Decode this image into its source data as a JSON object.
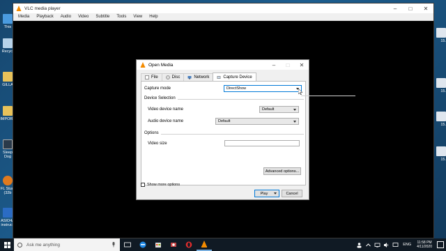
{
  "desktop": {
    "left_icons": [
      {
        "label": "This",
        "icon": "this-pc-icon"
      },
      {
        "label": "Recycl",
        "icon": "recycle-bin-icon"
      },
      {
        "label": "GILLA",
        "icon": "folder-icon"
      },
      {
        "label": "IMPORT",
        "icon": "folder-icon"
      },
      {
        "label": "Sleep Dog",
        "icon": "app-icon"
      },
      {
        "label": "FL Studi (32b",
        "icon": "fl-studio-icon"
      },
      {
        "label": "ASIO4A instructi",
        "icon": "document-icon"
      }
    ],
    "right_icons": [
      {
        "label": "15.",
        "icon": "file-icon"
      },
      {
        "label": "15.",
        "icon": "file-icon"
      },
      {
        "label": "15.",
        "icon": "file-icon"
      },
      {
        "label": "15.",
        "icon": "file-icon"
      }
    ]
  },
  "vlc": {
    "title": "VLC media player",
    "menu": [
      "Media",
      "Playback",
      "Audio",
      "Video",
      "Subtitle",
      "Tools",
      "View",
      "Help"
    ]
  },
  "dialog": {
    "title": "Open Media",
    "tabs": [
      {
        "label": "File",
        "icon": "file-tab-icon"
      },
      {
        "label": "Disc",
        "icon": "disc-tab-icon"
      },
      {
        "label": "Network",
        "icon": "network-tab-icon"
      },
      {
        "label": "Capture Device",
        "icon": "capture-device-tab-icon"
      }
    ],
    "active_tab": "Capture Device",
    "capture_mode_label": "Capture mode",
    "capture_mode_value": "DirectShow",
    "device_selection_label": "Device Selection",
    "video_device_label": "Video device name",
    "video_device_value": "Default",
    "audio_device_label": "Audio device name",
    "audio_device_value": "Default",
    "options_label": "Options",
    "video_size_label": "Video size",
    "video_size_value": "",
    "advanced_button": "Advanced options...",
    "show_more_label": "Show more options",
    "play_button": "Play",
    "cancel_button": "Cancel"
  },
  "taskbar": {
    "search_placeholder": "Ask me anything",
    "language": "ENG",
    "time": "11:58 PM",
    "date": "4/11/2020"
  },
  "colors": {
    "accent": "#0078d7",
    "vlc_orange": "#f48b00"
  }
}
